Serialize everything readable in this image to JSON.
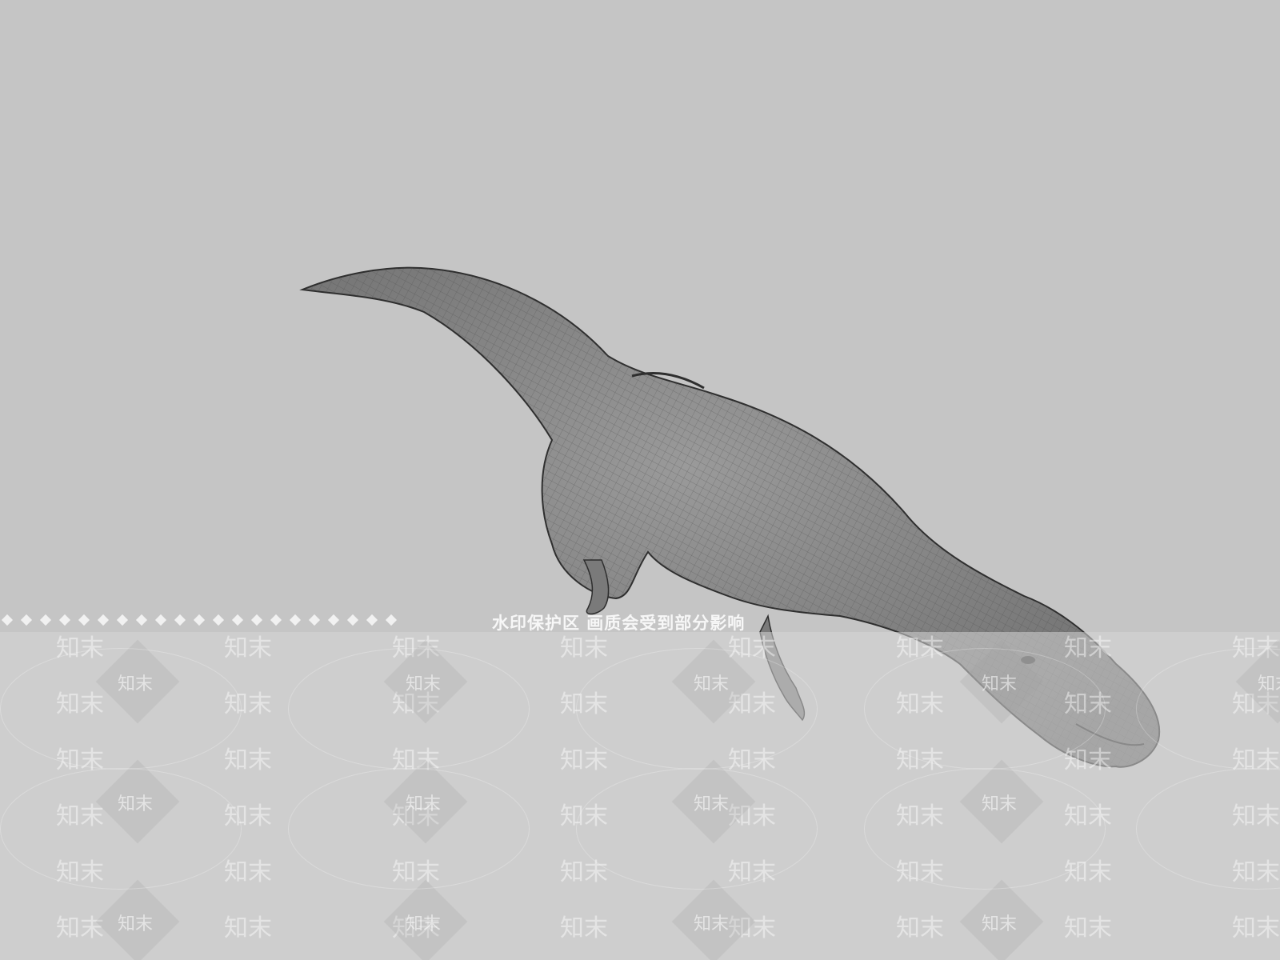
{
  "viewport": {
    "background": "#c5c5c5",
    "model_name": "dinosaur-wireframe-model"
  },
  "watermark": {
    "notice_text": "水印保护区 画质会受到部分影响",
    "tile_text": "知末",
    "color": "#ffffff"
  },
  "model": {
    "fill": "#8a8a8a",
    "wire_color": "#3a3a3a"
  }
}
